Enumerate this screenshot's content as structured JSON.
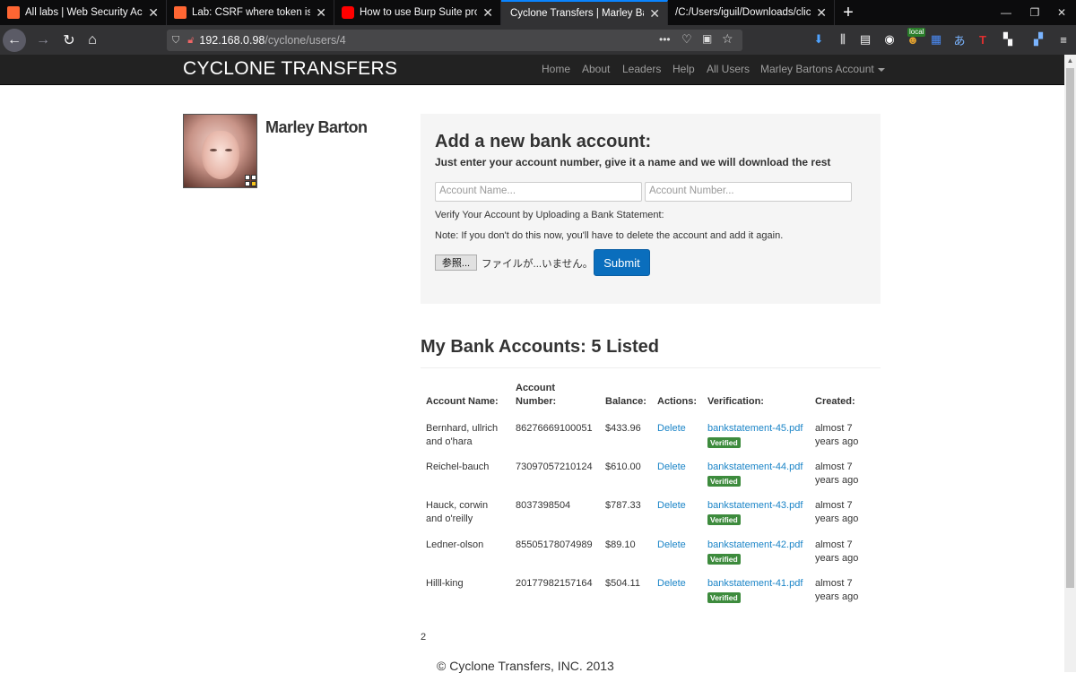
{
  "browser": {
    "tabs": [
      {
        "title": "All labs | Web Security Academ",
        "icon": "portswigger-icon",
        "color": "#ff6633"
      },
      {
        "title": "Lab: CSRF where token is not ti",
        "icon": "portswigger-icon",
        "color": "#ff6633"
      },
      {
        "title": "How to use Burp Suite projects",
        "icon": "youtube-icon",
        "color": "#ff0000"
      },
      {
        "title": "Cyclone Transfers | Marley Barton",
        "icon": "page-icon",
        "color": "#ffffff"
      },
      {
        "title": "/C:/Users/iguil/Downloads/clickjack",
        "icon": "file-icon",
        "color": "#ffffff"
      }
    ],
    "url_host": "192.168.0.98",
    "url_path": "/cyclone/users/4",
    "url_actions": "•••",
    "local_badge": "local"
  },
  "site": {
    "brand": "CYCLONE TRANSFERS",
    "nav": [
      "Home",
      "About",
      "Leaders",
      "Help",
      "All Users",
      "Marley Bartons Account"
    ]
  },
  "profile": {
    "name": "Marley Barton"
  },
  "add_account": {
    "title": "Add a new bank account:",
    "subtitle": "Just enter your account number, give it a name and we will download the rest",
    "name_placeholder": "Account Name...",
    "number_placeholder": "Account Number...",
    "verify_text": "Verify Your Account by Uploading a Bank Statement:",
    "note_text": "Note: If you don't do this now, you'll have to delete the account and add it again.",
    "browse_label": "参照...",
    "file_status": "ファイルが...いません。",
    "submit_label": "Submit"
  },
  "accounts": {
    "heading": "My Bank Accounts: 5 Listed",
    "columns": [
      "Account Name:",
      "Account Number:",
      "Balance:",
      "Actions:",
      "Verification:",
      "Created:"
    ],
    "rows": [
      {
        "name": "Bernhard, ullrich and o'hara",
        "number": "86276669100051",
        "balance": "$433.96",
        "action": "Delete",
        "file": "bankstatement-45.pdf",
        "status": "Verified",
        "created": "almost 7 years ago"
      },
      {
        "name": "Reichel-bauch",
        "number": "73097057210124",
        "balance": "$610.00",
        "action": "Delete",
        "file": "bankstatement-44.pdf",
        "status": "Verified",
        "created": "almost 7 years ago"
      },
      {
        "name": "Hauck, corwin and o'reilly",
        "number": "8037398504",
        "balance": "$787.33",
        "action": "Delete",
        "file": "bankstatement-43.pdf",
        "status": "Verified",
        "created": "almost 7 years ago"
      },
      {
        "name": "Ledner-olson",
        "number": "85505178074989",
        "balance": "$89.10",
        "action": "Delete",
        "file": "bankstatement-42.pdf",
        "status": "Verified",
        "created": "almost 7 years ago"
      },
      {
        "name": "Hilll-king",
        "number": "20177982157164",
        "balance": "$504.11",
        "action": "Delete",
        "file": "bankstatement-41.pdf",
        "status": "Verified",
        "created": "almost 7 years ago"
      }
    ],
    "page": "2"
  },
  "footer": {
    "text": "© Cyclone Transfers, INC. 2013"
  }
}
